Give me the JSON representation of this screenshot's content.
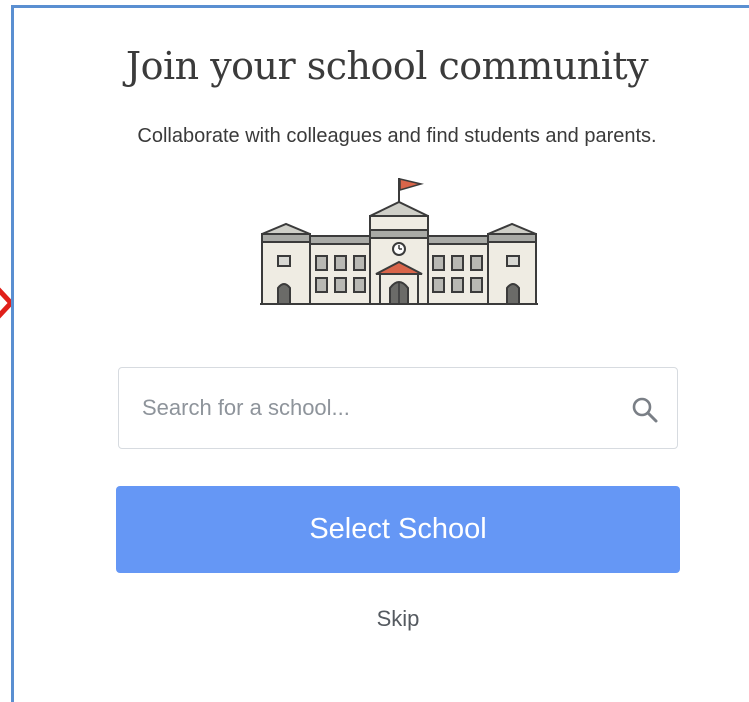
{
  "header": {
    "title": "Join your school community",
    "subtitle": "Collaborate with colleagues and find students and parents."
  },
  "illustration": {
    "icon": "school-building-icon"
  },
  "search": {
    "placeholder": "Search for a school...",
    "value": "",
    "icon": "search-icon"
  },
  "actions": {
    "select_label": "Select School",
    "skip_label": "Skip"
  },
  "colors": {
    "accent": "#6597f5",
    "frame_border": "#5a8fd1",
    "indicator": "#e0201a",
    "roof": "#d9654a"
  }
}
